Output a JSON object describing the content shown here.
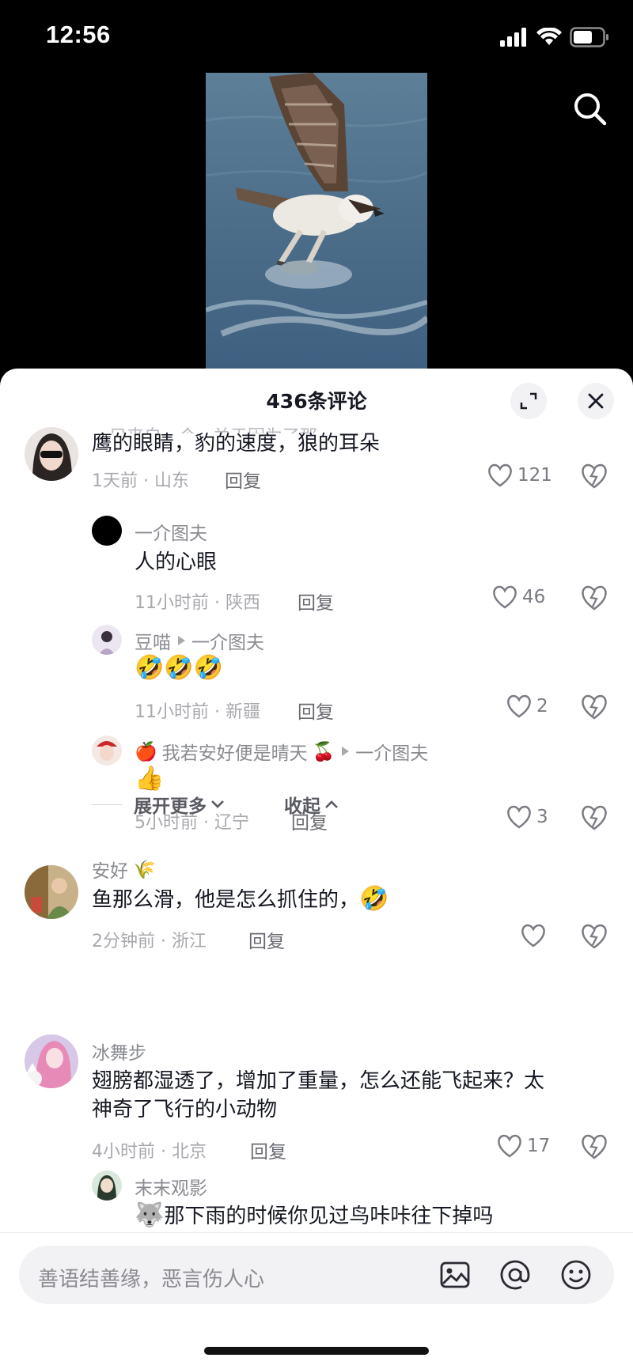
{
  "status": {
    "time": "12:56"
  },
  "sheet": {
    "title": "436条评论"
  },
  "clipped_name": "一只来自一个 · 关于因为了那",
  "comments": [
    {
      "text": "鹰的眼睛，豹的速度，狼的耳朵",
      "meta": "1天前 · 山东",
      "reply": "回复",
      "likes": "121"
    },
    {
      "user": "一介图夫",
      "text": "人的心眼",
      "meta": "11小时前 · 陕西",
      "reply": "回复",
      "likes": "46"
    },
    {
      "user": "豆喵",
      "reply_to": "一介图夫",
      "emojis": "🤣🤣🤣",
      "meta": "11小时前 · 新疆",
      "reply": "回复",
      "likes": "2"
    },
    {
      "user_prefix": "🍎",
      "user": "我若安好便是晴天",
      "user_suffix": "🍒",
      "reply_to": "一介图夫",
      "emojis": "👍",
      "meta": "5小时前 · 辽宁",
      "reply": "回复",
      "likes": "3"
    },
    {
      "user": "安好",
      "user_suffix": "🌾",
      "text": "鱼那么滑，他是怎么抓住的，",
      "emojis": "🤣",
      "meta": "2分钟前 · 浙江",
      "reply": "回复",
      "likes": ""
    },
    {
      "user": "冰舞步",
      "text_line1": "翅膀都湿透了，增加了重量，怎么还能飞起来？太",
      "text_line2": "神奇了飞行的小动物",
      "meta": "4小时前 · 北京",
      "reply": "回复",
      "likes": "17"
    },
    {
      "user": "末末观影",
      "emojis": "🐺",
      "text": "那下雨的时候你见过鸟咔咔往下掉吗"
    }
  ],
  "expand": {
    "more": "展开更多",
    "collapse": "收起"
  },
  "input": {
    "placeholder": "善语结善缘，恶言伤人心"
  },
  "icons": [
    "signal-icon",
    "wifi-icon",
    "battery-icon",
    "search-icon",
    "expand-icon",
    "close-icon",
    "heart-icon",
    "dislike-icon",
    "image-icon",
    "at-icon",
    "emoji-icon"
  ]
}
